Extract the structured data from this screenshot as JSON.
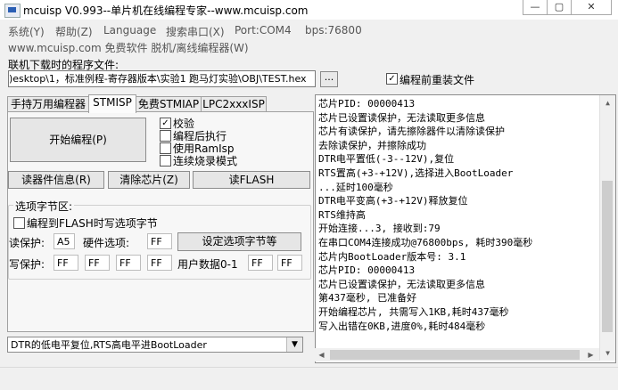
{
  "window": {
    "title": "mcuisp V0.993--单片机在线编程专家--www.mcuisp.com",
    "min_glyph": "—",
    "max_glyph": "▢",
    "close_glyph": "✕"
  },
  "menu": {
    "items": [
      "系统(Y)",
      "帮助(Z)",
      "Language",
      "搜索串口(X)",
      "Port:COM4",
      "bps:76800"
    ],
    "items2": [
      "www.mcuisp.com 免费软件 脱机/离线编程器(W)"
    ]
  },
  "file": {
    "label": "联机下载时的程序文件:",
    "path": ")esktop\\1，标准例程-寄存器版本\\实验1 跑马灯实验\\OBJ\\TEST.hex",
    "browse_label": "...",
    "reload_label": "编程前重装文件",
    "reload_checked": true
  },
  "tabs": [
    "手持万用编程器",
    "STMISP",
    "免费STMIAP",
    "LPC2xxxISP"
  ],
  "active_tab": "STMISP",
  "stmisp": {
    "start_button": "开始编程(P)",
    "options": [
      {
        "label": "校验",
        "checked": true
      },
      {
        "label": "编程后执行",
        "checked": false
      },
      {
        "label": "使用RamIsp",
        "checked": false
      },
      {
        "label": "连续烧录模式",
        "checked": false
      }
    ],
    "read_info_button": "读器件信息(R)",
    "erase_button": "清除芯片(Z)",
    "read_flash_button": "读FLASH"
  },
  "option_bytes": {
    "group_label": "选项字节区:",
    "write_to_flash_label": "编程到FLASH时写选项字节",
    "write_to_flash_checked": false,
    "read_protect_label": "读保护:",
    "read_protect_value": "A5",
    "hw_option_label": "硬件选项:",
    "hw_option_value": "FF",
    "set_button": "设定选项字节等",
    "write_protect_label": "写保护:",
    "write_protect_values": [
      "FF",
      "FF",
      "FF",
      "FF"
    ],
    "user_data_label": "用户数据0-1",
    "user_data_values": [
      "FF",
      "FF"
    ]
  },
  "dtr_rts_combo": "DTR的低电平复位,RTS高电平进BootLoader",
  "log": [
    "芯片PID: 00000413",
    "芯片已设置读保护，无法读取更多信息",
    "芯片有读保护，请先擦除器件以清除读保护",
    "去除读保护，并擦除成功",
    "DTR电平置低(-3--12V),复位",
    "RTS置高(+3-+12V),选择进入BootLoader",
    "...延时100毫秒",
    "DTR电平变高(+3-+12V)释放复位",
    "RTS维持高",
    "开始连接...3, 接收到:79",
    "在串口COM4连接成功@76800bps, 耗时390毫秒",
    "芯片内BootLoader版本号: 3.1",
    "芯片PID: 00000413",
    "芯片已设置读保护，无法读取更多信息",
    "第437毫秒, 已准备好",
    "开始编程芯片, 共需写入1KB,耗时437毫秒",
    "写入出错在0KB,进度0%,耗时484毫秒"
  ]
}
